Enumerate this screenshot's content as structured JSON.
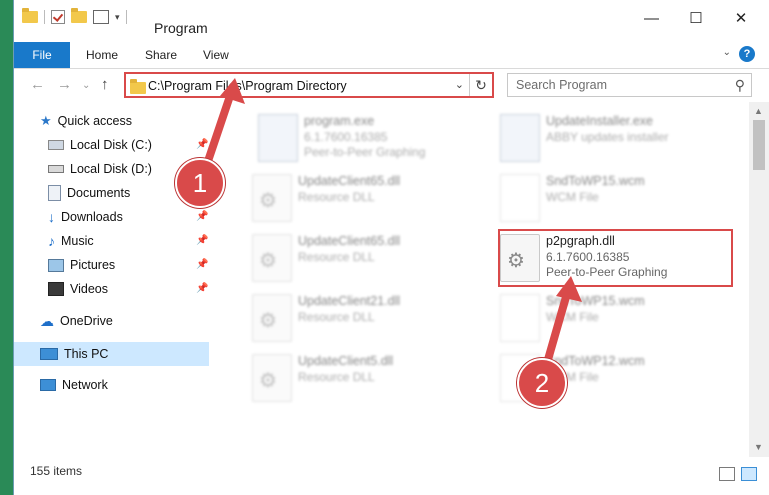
{
  "window": {
    "title": "Program"
  },
  "ribbon": {
    "tabs": [
      "File",
      "Home",
      "Share",
      "View"
    ]
  },
  "address": {
    "path": "C:\\Program Files\\Program Directory"
  },
  "search": {
    "placeholder": "Search Program"
  },
  "nav": {
    "quick_access": "Quick access",
    "items": [
      "Local Disk (C:)",
      "Local Disk (D:)",
      "Documents",
      "Downloads",
      "Music",
      "Pictures",
      "Videos"
    ],
    "onedrive": "OneDrive",
    "this_pc": "This PC",
    "network": "Network"
  },
  "files": [
    {
      "name": "program.exe",
      "line1": "6.1.7600.16385",
      "line2": "Peer-to-Peer Graphing",
      "icon": "exe-icon"
    },
    {
      "name": "UpdateInstaller.exe",
      "line1": "ABBY updates installer",
      "line2": "",
      "icon": "exe-icon"
    },
    {
      "name": "UpdateClient65.dll",
      "line1": "Resource DLL",
      "line2": "",
      "icon": "dll-icon"
    },
    {
      "name": "SndToWP15.wcm",
      "line1": "WCM File",
      "line2": "",
      "icon": "document-icon"
    },
    {
      "name": "UpdateClient65.dll",
      "line1": "Resource DLL",
      "line2": "",
      "icon": "dll-icon"
    },
    {
      "name": "p2pgraph.dll",
      "line1": "6.1.7600.16385",
      "line2": "Peer-to-Peer Graphing",
      "icon": "dll-icon"
    },
    {
      "name": "UpdateClient21.dll",
      "line1": "Resource DLL",
      "line2": "",
      "icon": "dll-icon"
    },
    {
      "name": "SndToWP15.wcm",
      "line1": "WCM File",
      "line2": "",
      "icon": "document-icon"
    },
    {
      "name": "UpdateClient5.dll",
      "line1": "Resource DLL",
      "line2": "",
      "icon": "dll-icon"
    },
    {
      "name": "SndToWP12.wcm",
      "line1": "WCM File",
      "line2": "",
      "icon": "document-icon"
    }
  ],
  "status": {
    "item_count": "155 items"
  },
  "callouts": [
    "1",
    "2"
  ],
  "colors": {
    "accent": "#1979ca",
    "highlight": "#d94a4a",
    "selection": "#cde8ff"
  }
}
